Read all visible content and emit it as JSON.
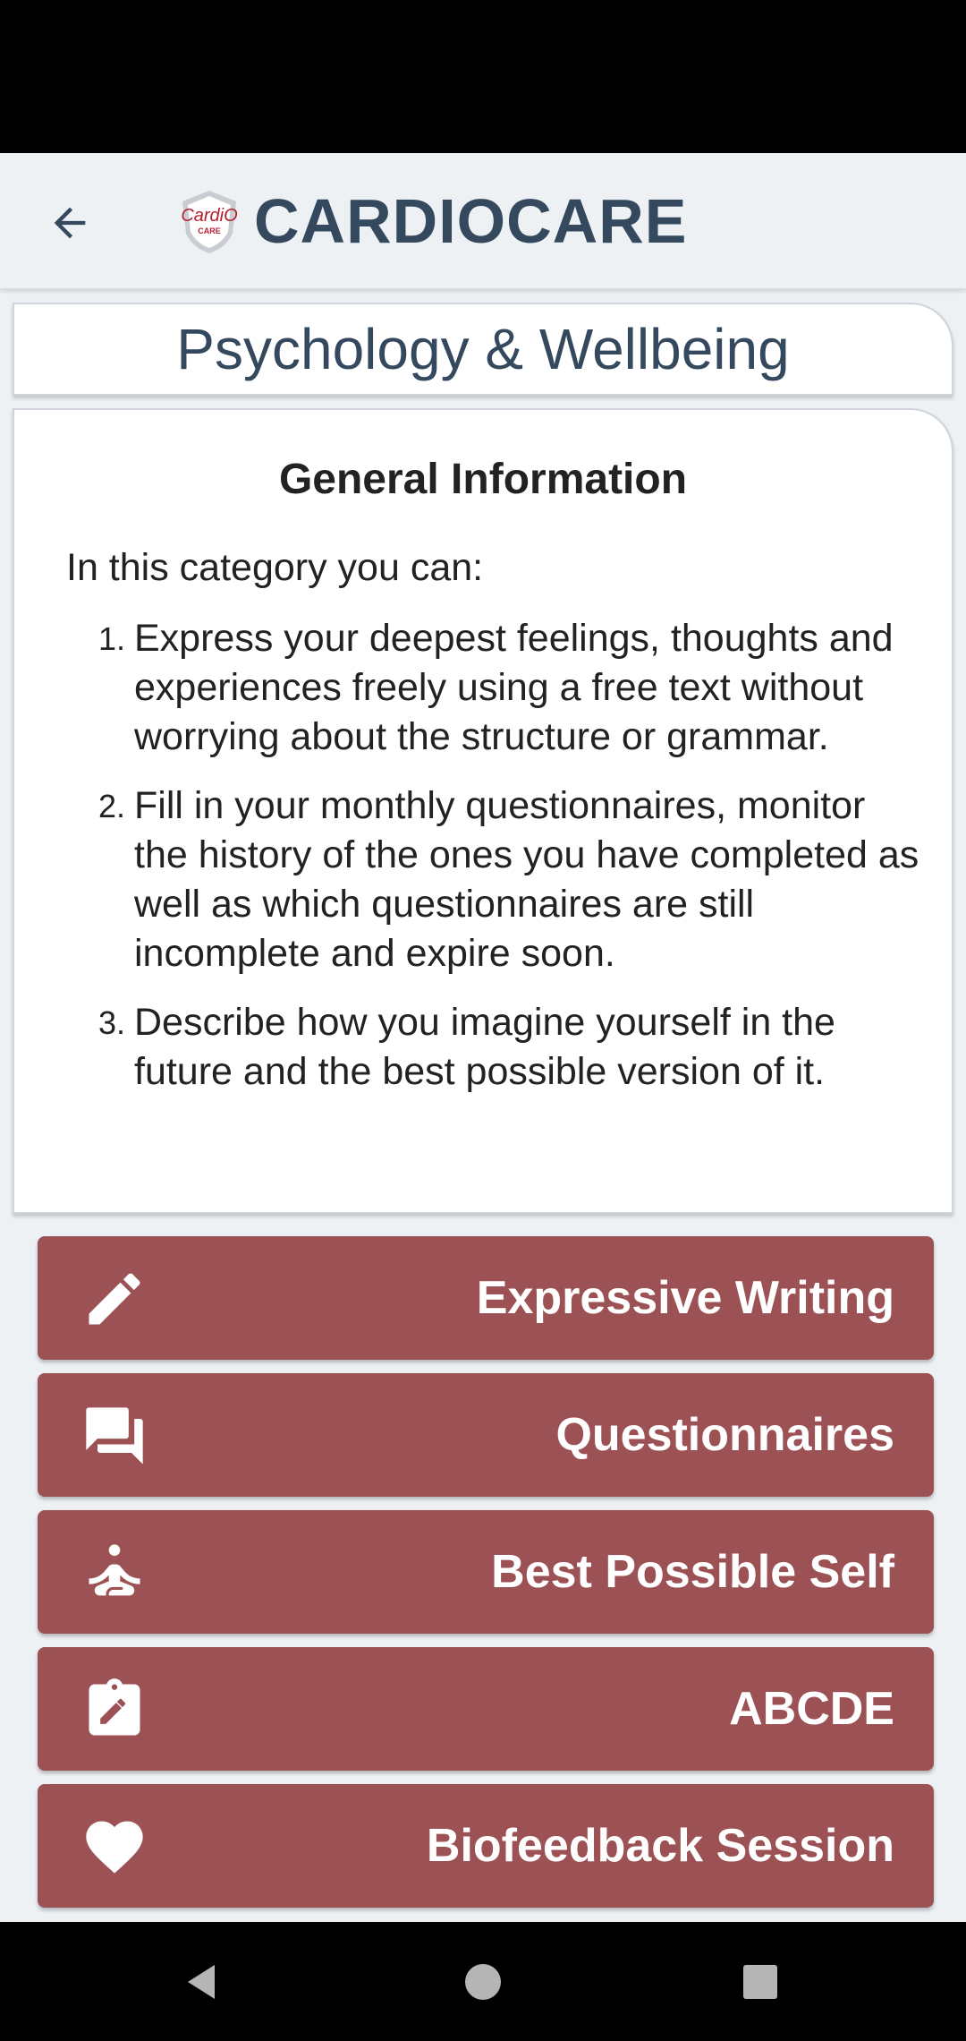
{
  "app": {
    "title": "CARDIOCARE",
    "logo_text": "CardiO CARE"
  },
  "section": {
    "title": "Psychology & Wellbeing"
  },
  "info": {
    "heading": "General Information",
    "intro": "In this category you can:",
    "items": [
      {
        "number": "1.",
        "text": "Express your deepest feelings, thoughts and experiences freely using a free text without worrying about the structure or grammar."
      },
      {
        "number": "2.",
        "text": "Fill in your monthly questionnaires, monitor the history of the ones you have completed as well as which questionnaires are still incomplete and expire soon."
      },
      {
        "number": "3.",
        "text": "Describe how you imagine yourself in the future and the best possible version of it."
      }
    ]
  },
  "menu": [
    {
      "label": "Expressive Writing",
      "icon": "pencil-icon"
    },
    {
      "label": "Questionnaires",
      "icon": "chat-bubbles-icon"
    },
    {
      "label": "Best Possible Self",
      "icon": "meditation-icon"
    },
    {
      "label": "ABCDE",
      "icon": "clipboard-edit-icon"
    },
    {
      "label": "Biofeedback Session",
      "icon": "heart-icon"
    }
  ],
  "colors": {
    "brand_text": "#34495e",
    "button_bg": "#9c5254",
    "background": "#eef1f4"
  }
}
